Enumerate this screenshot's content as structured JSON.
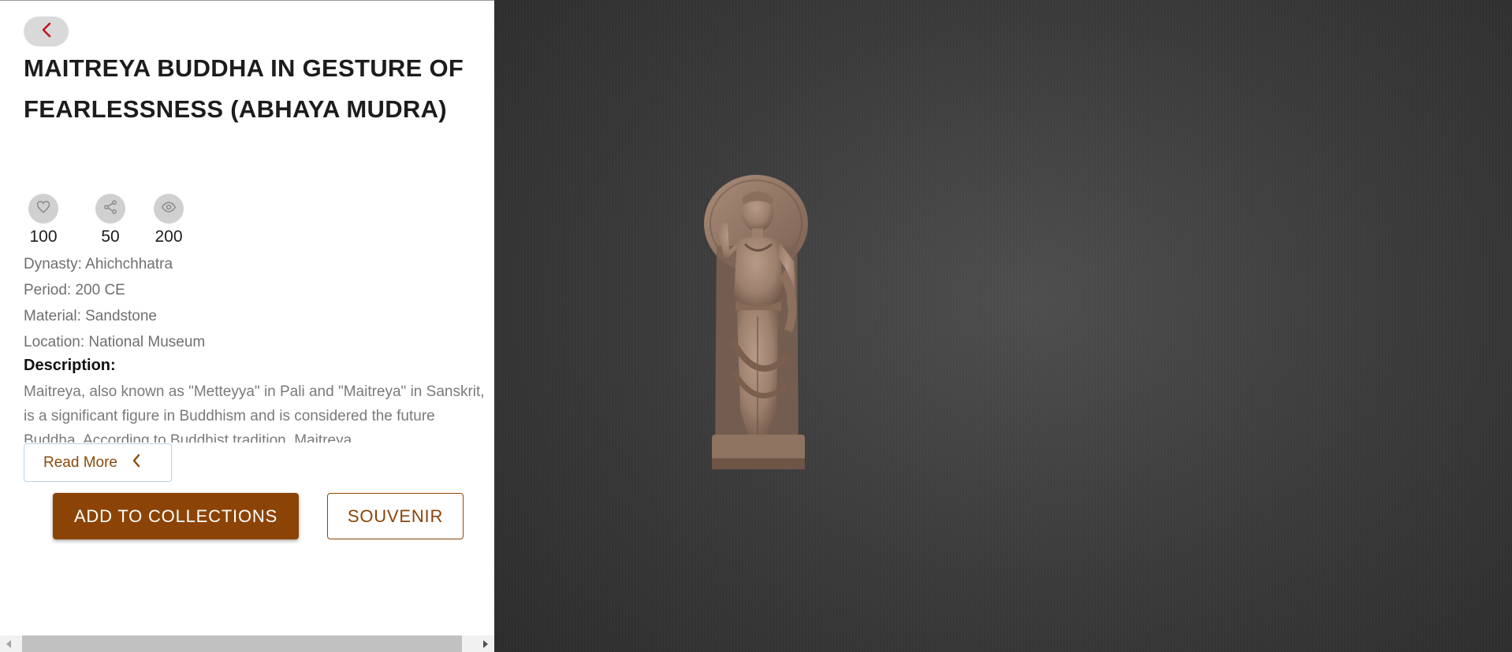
{
  "artifact": {
    "title": "MAITREYA BUDDHA IN GESTURE OF FEARLESSNESS (ABHAYA MUDRA)"
  },
  "stats": {
    "likes": "100",
    "shares": "50",
    "views": "200"
  },
  "meta": {
    "dynasty": "Dynasty: Ahichchhatra",
    "period": "Period: 200 CE",
    "material": "Material: Sandstone",
    "location": "Location: National Museum"
  },
  "description": {
    "heading": "Description:",
    "text": "Maitreya, also known as \"Metteyya\" in Pali and \"Maitreya\" in Sanskrit, is a significant figure in Buddhism and is considered the future Buddha. According to Buddhist tradition, Maitreya"
  },
  "actions": {
    "read_more_label": "Read More",
    "add_to_collections_label": "ADD TO COLLECTIONS",
    "souvenir_label": "SOUVENIR"
  },
  "icons": {
    "back": "chevron-left-icon",
    "like": "heart-icon",
    "share": "share-icon",
    "view": "eye-icon",
    "read_more": "chevron-left-icon"
  },
  "colors": {
    "brand": "#8c4406",
    "back_chevron": "#c4161c"
  }
}
